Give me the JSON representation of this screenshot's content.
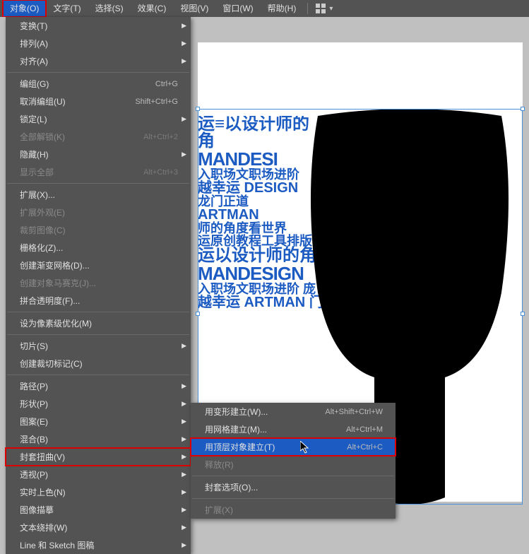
{
  "menubar": {
    "items": [
      "对象(O)",
      "文字(T)",
      "选择(S)",
      "效果(C)",
      "视图(V)",
      "窗口(W)",
      "帮助(H)"
    ]
  },
  "menu1": {
    "groups": [
      [
        {
          "label": "变换(T)",
          "arrow": true
        },
        {
          "label": "排列(A)",
          "arrow": true
        },
        {
          "label": "对齐(A)",
          "arrow": true
        }
      ],
      [
        {
          "label": "编组(G)",
          "shortcut": "Ctrl+G"
        },
        {
          "label": "取消编组(U)",
          "shortcut": "Shift+Ctrl+G"
        },
        {
          "label": "锁定(L)",
          "arrow": true
        },
        {
          "label": "全部解锁(K)",
          "shortcut": "Alt+Ctrl+2",
          "disabled": true
        },
        {
          "label": "隐藏(H)",
          "arrow": true
        },
        {
          "label": "显示全部",
          "shortcut": "Alt+Ctrl+3",
          "disabled": true
        }
      ],
      [
        {
          "label": "扩展(X)..."
        },
        {
          "label": "扩展外观(E)",
          "disabled": true
        },
        {
          "label": "裁剪图像(C)",
          "disabled": true
        },
        {
          "label": "栅格化(Z)..."
        },
        {
          "label": "创建渐变网格(D)..."
        },
        {
          "label": "创建对象马赛克(J)...",
          "disabled": true
        },
        {
          "label": "拼合透明度(F)..."
        }
      ],
      [
        {
          "label": "设为像素级优化(M)"
        }
      ],
      [
        {
          "label": "切片(S)",
          "arrow": true
        },
        {
          "label": "创建裁切标记(C)"
        }
      ],
      [
        {
          "label": "路径(P)",
          "arrow": true
        },
        {
          "label": "形状(P)",
          "arrow": true
        },
        {
          "label": "图案(E)",
          "arrow": true
        },
        {
          "label": "混合(B)",
          "arrow": true
        },
        {
          "label": "封套扭曲(V)",
          "arrow": true,
          "highlighted": true
        },
        {
          "label": "透视(P)",
          "arrow": true
        },
        {
          "label": "实时上色(N)",
          "arrow": true
        },
        {
          "label": "图像描摹",
          "arrow": true
        },
        {
          "label": "文本绕排(W)",
          "arrow": true
        },
        {
          "label": "Line 和 Sketch 图稿",
          "arrow": true
        }
      ]
    ]
  },
  "menu2": {
    "groups": [
      [
        {
          "label": "用变形建立(W)...",
          "shortcut": "Alt+Shift+Ctrl+W"
        },
        {
          "label": "用网格建立(M)...",
          "shortcut": "Alt+Ctrl+M"
        },
        {
          "label": "用顶层对象建立(T)",
          "shortcut": "Alt+Ctrl+C",
          "highlighted": true,
          "hovered": true
        },
        {
          "label": "释放(R)",
          "disabled": true
        }
      ],
      [
        {
          "label": "封套选项(O)..."
        }
      ],
      [
        {
          "label": "扩展(X)",
          "disabled": true
        }
      ]
    ]
  },
  "bg_text": {
    "l1": "运≡以设计师的角",
    "l2": "MANDESI",
    "l3": "入职场文职场进阶",
    "l4": "越幸运 DESIGN",
    "l5": "龙门正道",
    "l6": "ARTMAN",
    "l7": "师的角度看世界",
    "l8": "运原创教程工具排版",
    "l9": "运以设计师的角",
    "l10": "MANDESIGN",
    "l11": "入职场文职场进阶 庞",
    "l12": "越幸运 ARTMAN 门"
  }
}
